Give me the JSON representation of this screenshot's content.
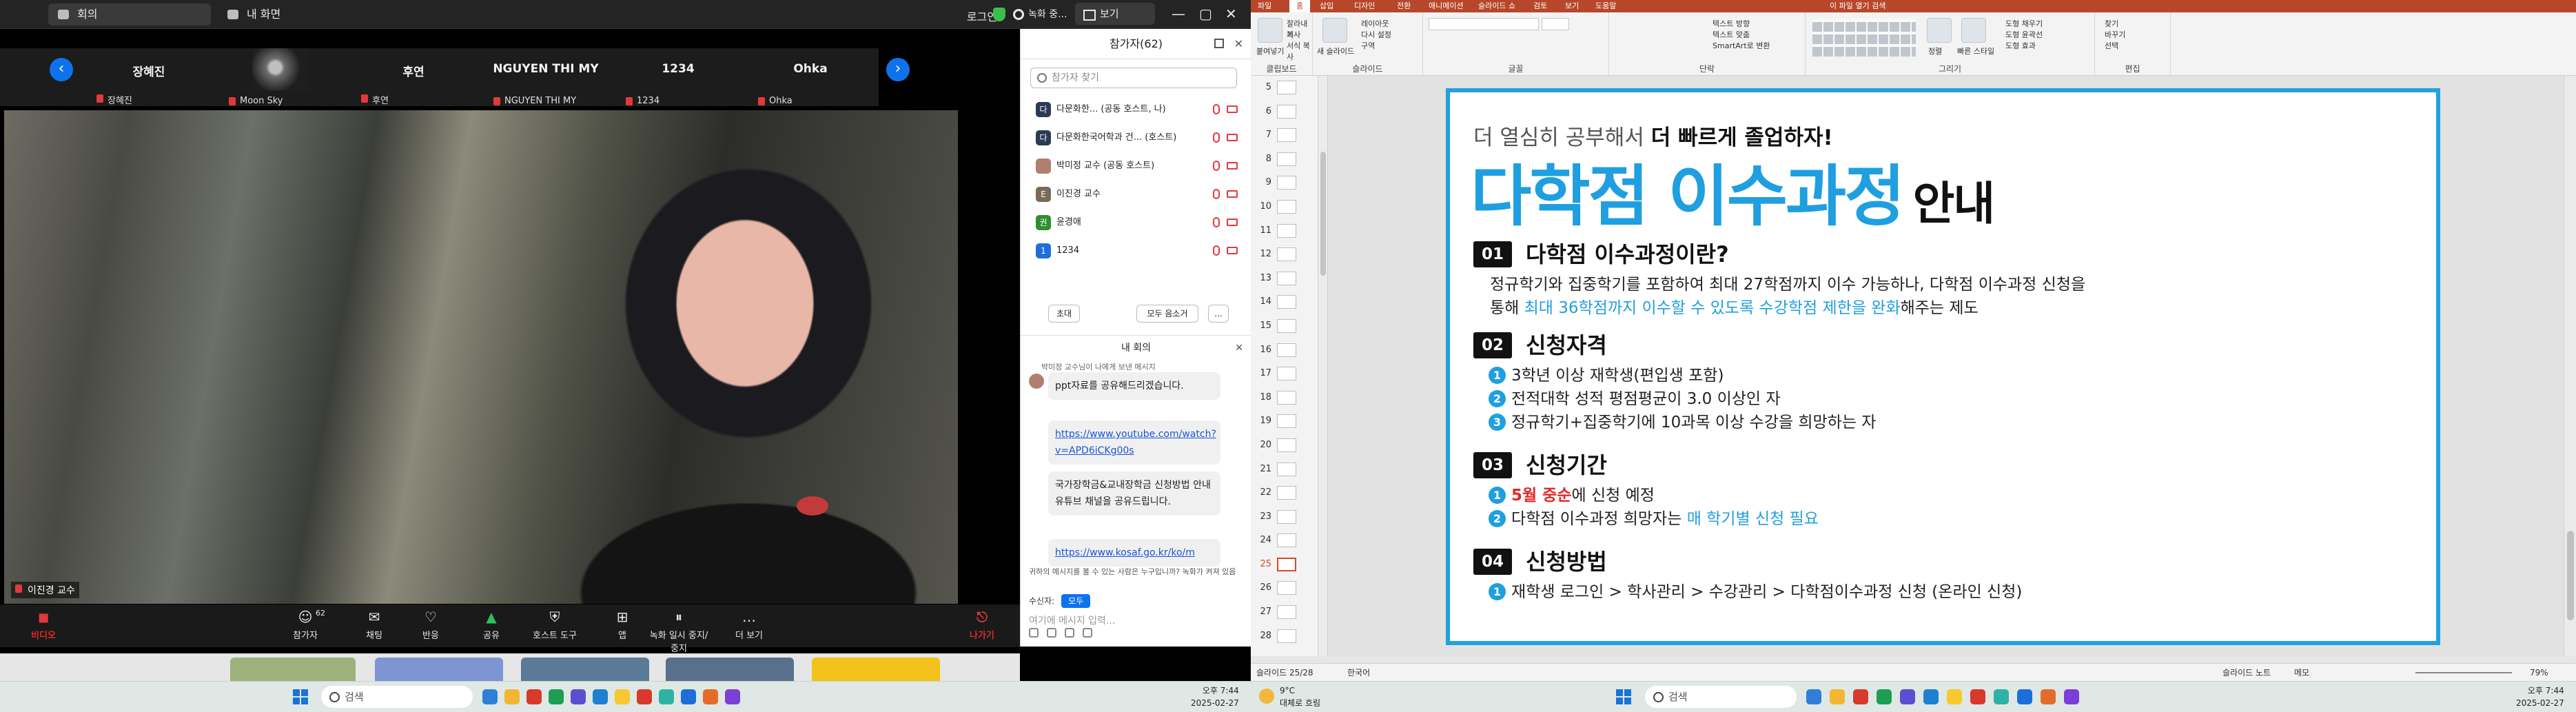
{
  "zoom": {
    "tabs": {
      "meeting": "회의",
      "my_screen": "내 화면"
    },
    "login": "로그인",
    "recording": "녹화 중...",
    "view_button": "보기",
    "window_controls": [
      "—",
      "▢",
      "✕"
    ],
    "strip_names": [
      "장혜진",
      "",
      "후연",
      "NGUYEN THI MY",
      "1234",
      "Ohka"
    ],
    "strip_labels": [
      "장혜진",
      "Moon Sky",
      "후연",
      "NGUYEN THI MY",
      "1234",
      "Ohka"
    ],
    "video_label": "이진경 교수",
    "controls": [
      {
        "label": "비디오",
        "icon": "video-off-icon",
        "glyph": "◼"
      },
      {
        "label": "참가자",
        "icon": "participants-icon",
        "glyph": "☺",
        "count": "62"
      },
      {
        "label": "채팅",
        "icon": "chat-icon",
        "glyph": "✉"
      },
      {
        "label": "반응",
        "icon": "heart-icon",
        "glyph": "♡"
      },
      {
        "label": "공유",
        "icon": "share-icon",
        "glyph": "▲"
      },
      {
        "label": "호스트 도구",
        "icon": "shield-icon",
        "glyph": "⛨"
      },
      {
        "label": "앱",
        "icon": "apps-icon",
        "glyph": "⊞"
      },
      {
        "label": "녹화 일시 중지/중지",
        "icon": "pause-stop-icon",
        "glyph": "⏸"
      },
      {
        "label": "더 보기",
        "icon": "more-icon",
        "glyph": "…"
      },
      {
        "label": "나가기",
        "icon": "leave-icon",
        "glyph": "⎋"
      }
    ],
    "panel": {
      "title": "참가자(62)",
      "search_placeholder": "참가자 찾기",
      "participants": [
        {
          "initial": "다",
          "name": "다문화한... (공동 호스트, 나)",
          "color": "#2b3a55"
        },
        {
          "initial": "다",
          "name": "다문화한국어학과 건... (호스트)",
          "color": "#2b3a55"
        },
        {
          "initial": "",
          "name": "박미정 교수 (공동 호스트)",
          "color": "#b07f6f"
        },
        {
          "initial": "E",
          "name": "이진경 교수",
          "color": "#7a6a5a"
        },
        {
          "initial": "권아",
          "name": "윤경애",
          "color": "#2f8f2f"
        },
        {
          "initial": "1",
          "name": "1234",
          "color": "#1e6fd9"
        }
      ],
      "invite": "초대",
      "mute_all": "모두 음소거",
      "more": "..."
    },
    "chat": {
      "title": "내 회의",
      "sender": "박미정 교수님이 나에게 보낸 메시지",
      "messages": [
        "ppt자료를 공유해드리겠습니다.",
        "https://www.youtube.com/watch?v=APD6iCKg00s",
        "국가장학금&교내장학금 신청방법 안내 유튜브 채널을 공유드립니다.",
        "https://www.kosaf.go.kr/ko/m"
      ],
      "note": "귀하의 메시지를 볼 수 있는 사람은 누구입니까? 녹화가 켜져 있음",
      "recipient_label": "수신자:",
      "recipient": "모두",
      "input_placeholder": "여기에 메시지 입력..."
    }
  },
  "taskbar_left": {
    "search": "검색",
    "time": "오후 7:44",
    "date": "2025-02-27",
    "tray": [
      "^",
      "A"
    ]
  },
  "taskbar_right": {
    "weather_temp": "9°C",
    "weather_desc": "대체로 흐림",
    "search": "검색",
    "time": "오후 7:44",
    "date": "2025-02-27"
  },
  "ppt": {
    "tabs": [
      "파일",
      "홈",
      "삽입",
      "디자인",
      "전환",
      "애니메이션",
      "슬라이드 쇼",
      "검토",
      "보기",
      "도움말"
    ],
    "title": "이 파일 열기 검색",
    "groups": [
      "클립보드",
      "슬라이드",
      "글꼴",
      "단락",
      "그리기",
      "편집"
    ],
    "ribbon_items": {
      "paste": "붙여넣기",
      "cut": "잘라내기",
      "copy": "복사",
      "format_painter": "서식 복사",
      "new_slide": "새 슬라이드",
      "layout": "레이아웃",
      "reset": "다시 설정",
      "section": "구역",
      "text_direction": "텍스트 방향",
      "align_text": "텍스트 맞춤",
      "smartart": "SmartArt로 변환",
      "arrange": "정렬",
      "quick_styles": "빠른 스타일",
      "shape_fill": "도형 채우기",
      "shape_outline": "도형 윤곽선",
      "shape_effects": "도형 효과",
      "find": "찾기",
      "replace": "바꾸기",
      "select": "선택"
    },
    "slide_numbers": [
      "5",
      "6",
      "7",
      "8",
      "9",
      "10",
      "11",
      "12",
      "13",
      "14",
      "15",
      "16",
      "17",
      "18",
      "19",
      "20",
      "21",
      "22",
      "23",
      "24",
      "25",
      "26",
      "27",
      "28"
    ],
    "selected_slide": "25",
    "status_left": "슬라이드 25/28",
    "status_lang": "한국어",
    "status_notes": "슬라이드 노트",
    "status_comments": "메모",
    "zoom": "79%",
    "slide": {
      "kicker_pre": "더 열심히 공부해서 ",
      "kicker_bold": "더 빠르게 졸업하자!",
      "title_main": "다학점 이수과정",
      "title_sub": "안내",
      "sections": [
        {
          "num": "01",
          "head": "다학점 이수과정이란?"
        },
        {
          "num": "02",
          "head": "신청자격"
        },
        {
          "num": "03",
          "head": "신청기간"
        },
        {
          "num": "04",
          "head": "신청방법"
        }
      ],
      "s1_line1": "정규학기와 집중학기를 포함하여 최대 27학점까지 이수 가능하나, 다학점 이수과정 신청을",
      "s1_line2_pre": "통해 ",
      "s1_line2_hl": "최대 36학점까지 이수할 수 있도록 수강학점 제한을 완화",
      "s1_line2_post": "해주는 제도",
      "s2_items": [
        "3학년 이상 재학생(편입생 포함)",
        "전적대학 성적 평점평균이 3.0 이상인 자",
        "정규학기+집중학기에 10과목 이상 수강을 희망하는 자"
      ],
      "s3_item1_red": "5월 중순",
      "s3_item1_rest": "에 신청 예정",
      "s3_item2_pre": "다학점 이수과정 희망자는 ",
      "s3_item2_hl": "매 학기별 신청 필요",
      "s4_item": "재학생 로그인 > 학사관리 > 수강관리 > 다학점이수과정 신청 (온라인 신청)",
      "bullets": [
        "1",
        "2",
        "3"
      ]
    }
  }
}
